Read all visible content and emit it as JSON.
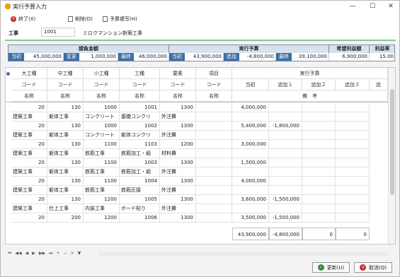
{
  "window": {
    "title": "実行予算入力"
  },
  "toolbar": {
    "exit": "終了(X)",
    "delete": "削除(D)",
    "copy": "予算複写(H)"
  },
  "kouji": {
    "label": "工事",
    "code": "1001",
    "name": "ミロクマンション新築工事"
  },
  "summary": {
    "contract_header": "請負金額",
    "budget_header": "実行予算",
    "profit_header": "希望利益額",
    "rate_header": "利益率",
    "initial_label": "当初",
    "change_label": "変更",
    "final_label": "最終",
    "add_label": "追加",
    "contract_initial": "45,000,000",
    "contract_change": "1,000,000",
    "contract_final": "46,000,000",
    "budget_initial": "43,900,000",
    "budget_add": "-4,800,000",
    "budget_final": "39,100,000",
    "profit": "6,900,000",
    "rate": "15.00"
  },
  "grid": {
    "header_row1": [
      "大工種",
      "中工種",
      "小工種",
      "工種",
      "要素",
      "項目"
    ],
    "header_row2": [
      "コード",
      "コード",
      "コード",
      "コード",
      "コード",
      "コード"
    ],
    "header_row3": [
      "名称",
      "名称",
      "名称",
      "名称",
      "名称",
      "名称"
    ],
    "budget_header": "実行予算",
    "budget_sub": [
      "当初",
      "追加１",
      "追加２",
      "追加３",
      "追"
    ],
    "remarks_header": "備　考",
    "rows": [
      {
        "codes": [
          "20",
          "130",
          "1000",
          "1001",
          "1300",
          ""
        ],
        "names": [
          "",
          "",
          "",
          "",
          "",
          ""
        ],
        "initial": "4,000,000",
        "add1": ""
      },
      {
        "codes": [
          "",
          "",
          "",
          "",
          "",
          ""
        ],
        "names": [
          "建築工事",
          "躯体工事",
          "コンクリート",
          "基礎コンクリ",
          "外注費",
          ""
        ],
        "initial": "",
        "add1": ""
      },
      {
        "codes": [
          "20",
          "130",
          "1000",
          "1002",
          "1300",
          ""
        ],
        "names": [
          "",
          "",
          "",
          "",
          "",
          ""
        ],
        "initial": "5,400,000",
        "add1": "-1,800,000"
      },
      {
        "codes": [
          "",
          "",
          "",
          "",
          "",
          ""
        ],
        "names": [
          "建築工事",
          "躯体工事",
          "コンクリート",
          "躯体コンクリ",
          "外注費",
          ""
        ],
        "initial": "",
        "add1": ""
      },
      {
        "codes": [
          "20",
          "130",
          "1100",
          "1103",
          "1200",
          ""
        ],
        "names": [
          "",
          "",
          "",
          "",
          "",
          ""
        ],
        "initial": "3,000,000",
        "add1": ""
      },
      {
        "codes": [
          "",
          "",
          "",
          "",
          "",
          ""
        ],
        "names": [
          "建築工事",
          "躯体工事",
          "鉄筋工事",
          "鉄筋加工・組",
          "材料費",
          ""
        ],
        "initial": "",
        "add1": ""
      },
      {
        "codes": [
          "20",
          "130",
          "1100",
          "1003",
          "1300",
          ""
        ],
        "names": [
          "",
          "",
          "",
          "",
          "",
          ""
        ],
        "initial": "1,500,000",
        "add1": ""
      },
      {
        "codes": [
          "",
          "",
          "",
          "",
          "",
          ""
        ],
        "names": [
          "建築工事",
          "躯体工事",
          "鉄筋工事",
          "鉄筋加工・組",
          "外注費",
          ""
        ],
        "initial": "",
        "add1": ""
      },
      {
        "codes": [
          "20",
          "130",
          "1100",
          "1004",
          "1300",
          ""
        ],
        "names": [
          "",
          "",
          "",
          "",
          "",
          ""
        ],
        "initial": "4,000,000",
        "add1": ""
      },
      {
        "codes": [
          "",
          "",
          "",
          "",
          "",
          ""
        ],
        "names": [
          "建築工事",
          "躯体工事",
          "鉄筋工事",
          "鉄筋圧接",
          "外注費",
          ""
        ],
        "initial": "",
        "add1": ""
      },
      {
        "codes": [
          "20",
          "130",
          "1200",
          "1005",
          "1300",
          ""
        ],
        "names": [
          "",
          "",
          "",
          "",
          "",
          ""
        ],
        "initial": "3,600,000",
        "add1": "-1,500,000"
      },
      {
        "codes": [
          "",
          "",
          "",
          "",
          "",
          ""
        ],
        "names": [
          "建築工事",
          "仕上工事",
          "内装工事",
          "ボード貼り",
          "外注費",
          ""
        ],
        "initial": "",
        "add1": ""
      },
      {
        "codes": [
          "20",
          "200",
          "1200",
          "1006",
          "1300",
          ""
        ],
        "names": [
          "",
          "",
          "",
          "",
          "",
          ""
        ],
        "initial": "3,500,000",
        "add1": "-1,500,000"
      }
    ],
    "totals": {
      "initial": "43,900,000",
      "add1": "-4,800,000",
      "add2": "0",
      "add3": "0"
    }
  },
  "nav": {
    "buttons": [
      "⏮",
      "◀◀",
      "◀",
      "▶",
      "▶▶",
      "⏭",
      "+",
      "−",
      "×",
      "▼"
    ]
  },
  "buttons": {
    "update": "更新(U)",
    "cancel": "取消(Q)"
  }
}
